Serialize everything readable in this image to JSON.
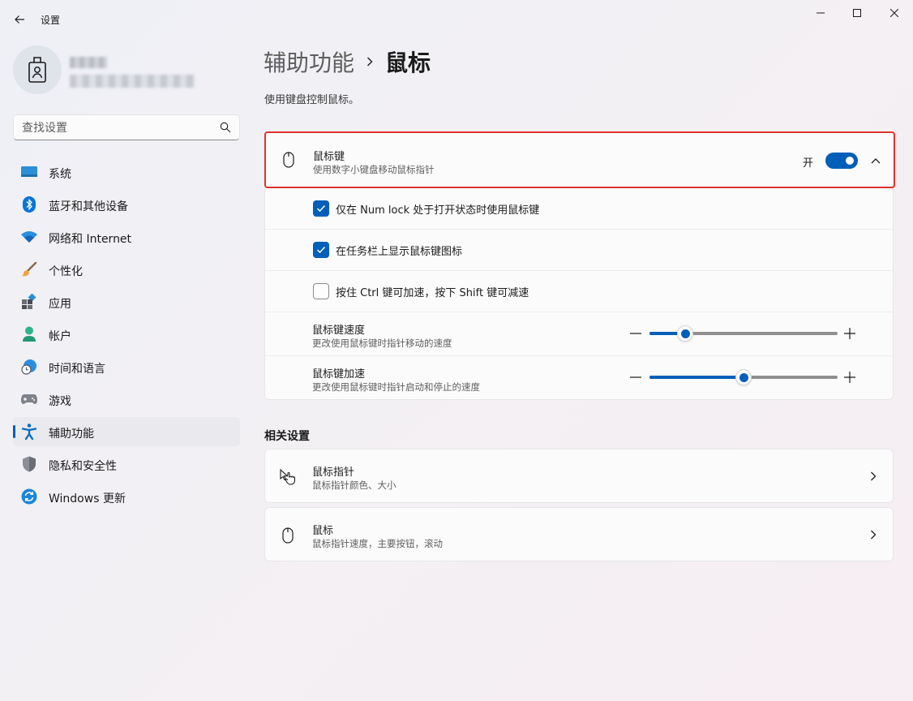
{
  "window": {
    "title": "设置"
  },
  "sidebar": {
    "search_placeholder": "查找设置",
    "items": [
      {
        "label": "系统",
        "icon": "system-icon"
      },
      {
        "label": "蓝牙和其他设备",
        "icon": "bluetooth-icon"
      },
      {
        "label": "网络和 Internet",
        "icon": "wifi-icon"
      },
      {
        "label": "个性化",
        "icon": "brush-icon"
      },
      {
        "label": "应用",
        "icon": "apps-icon"
      },
      {
        "label": "帐户",
        "icon": "account-icon"
      },
      {
        "label": "时间和语言",
        "icon": "globe-clock-icon"
      },
      {
        "label": "游戏",
        "icon": "gamepad-icon"
      },
      {
        "label": "辅助功能",
        "icon": "accessibility-icon",
        "active": true
      },
      {
        "label": "隐私和安全性",
        "icon": "shield-icon"
      },
      {
        "label": "Windows 更新",
        "icon": "update-icon"
      }
    ]
  },
  "main": {
    "breadcrumb_parent": "辅助功能",
    "breadcrumb_current": "鼠标",
    "description": "使用键盘控制鼠标。",
    "mouse_keys": {
      "title": "鼠标键",
      "subtitle": "使用数字小键盘移动鼠标指针",
      "toggle_label": "开",
      "toggle_on": true,
      "options": [
        {
          "label": "仅在 Num lock 处于打开状态时使用鼠标键",
          "checked": true
        },
        {
          "label": "在任务栏上显示鼠标键图标",
          "checked": true
        },
        {
          "label": "按住 Ctrl 键可加速，按下 Shift 键可减速",
          "checked": false
        }
      ],
      "speed": {
        "title": "鼠标键速度",
        "subtitle": "更改使用鼠标键时指针移动的速度",
        "value_fraction": 0.19
      },
      "acceleration": {
        "title": "鼠标键加速",
        "subtitle": "更改使用鼠标键时指针启动和停止的速度",
        "value_fraction": 0.5
      }
    },
    "related": {
      "title": "相关设置",
      "items": [
        {
          "title": "鼠标指针",
          "subtitle": "鼠标指针颜色、大小",
          "icon": "pointer-hand-icon"
        },
        {
          "title": "鼠标",
          "subtitle": "鼠标指针速度，主要按钮，滚动",
          "icon": "mouse-icon"
        }
      ]
    }
  },
  "colors": {
    "accent": "#005fb8",
    "highlight_border": "#e0322a"
  }
}
